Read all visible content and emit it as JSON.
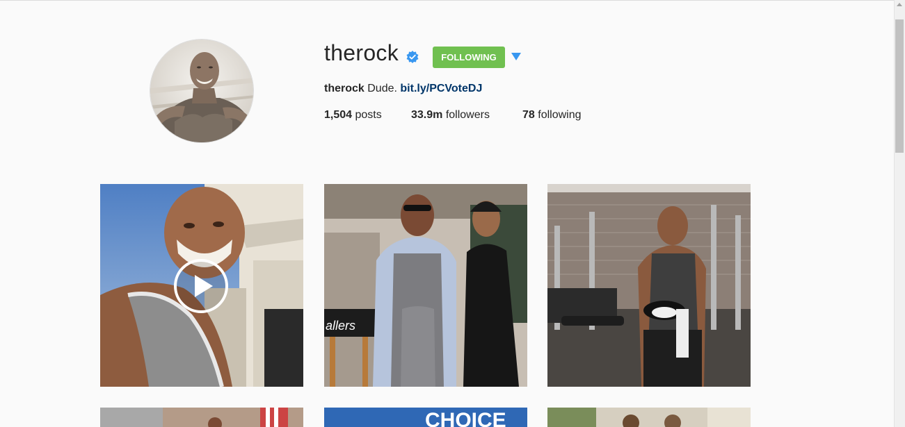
{
  "profile": {
    "username": "therock",
    "verified_icon": "verified-badge-icon",
    "follow_label": "FOLLOWING",
    "follow_color": "#70c050",
    "options_icon": "caret-down-icon",
    "bio_name": "therock",
    "bio_text": "Dude.",
    "bio_link": "bit.ly/PCVoteDJ",
    "stats": {
      "posts_count": "1,504",
      "posts_label": "posts",
      "followers_count": "33.9m",
      "followers_label": "followers",
      "following_count": "78",
      "following_label": "following"
    }
  },
  "posts": [
    {
      "type": "video",
      "icon": "play-icon"
    },
    {
      "type": "photo",
      "caption_visible": "allers"
    },
    {
      "type": "photo"
    },
    {
      "type": "photo"
    },
    {
      "type": "photo",
      "caption_visible": "CHOICE"
    },
    {
      "type": "photo"
    }
  ],
  "colors": {
    "background": "#fafafa",
    "link": "#003569",
    "accent_blue": "#3897f0"
  }
}
